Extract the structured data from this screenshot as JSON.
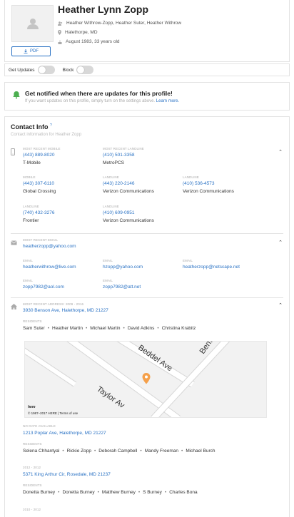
{
  "profile": {
    "name": "Heather Lynn Zopp",
    "aliases": "Heather Withrow-Zopp, Heather Suter, Heather Withrow",
    "location": "Halethorpe, MD",
    "birth": "August 1983, 33 years old",
    "pdf_label": "PDF"
  },
  "toggles": {
    "updates_label": "Get Updates",
    "block_label": "Block"
  },
  "notify": {
    "title": "Get notified when there are updates for this profile!",
    "subtitle": "If you want updates on this profile, simply turn on the settings above.",
    "link": "Learn more."
  },
  "contact": {
    "title": "Contact Info",
    "superscript": "?",
    "subtitle": "Contact information for Heather Zopp"
  },
  "phones": [
    {
      "label": "MOST RECENT MOBILE",
      "number": "(443) 889-8020",
      "carrier": "T-Mobile"
    },
    {
      "label": "MOST RECENT LANDLINE",
      "number": "(410) 501-3358",
      "carrier": "MetroPCS"
    },
    {
      "label": "MOBILE",
      "number": "(443) 307-6110",
      "carrier": "Global Crossing"
    },
    {
      "label": "LANDLINE",
      "number": "(443) 220-2146",
      "carrier": "Verizon Communications"
    },
    {
      "label": "LANDLINE",
      "number": "(410) 536-4573",
      "carrier": "Verizon Communications"
    },
    {
      "label": "LANDLINE",
      "number": "(740) 432-3276",
      "carrier": "Frontier"
    },
    {
      "label": "LANDLINE",
      "number": "(410) 609-0951",
      "carrier": "Verizon Communications"
    }
  ],
  "emails": [
    {
      "label": "MOST RECENT EMAIL",
      "value": "heatherzopp@yahoo.com"
    },
    {
      "label": "EMAIL",
      "value": "heatherwithrow@live.com"
    },
    {
      "label": "EMAIL",
      "value": "hzopp@yahoo.com"
    },
    {
      "label": "EMAIL",
      "value": "heatherzopp@netscape.net"
    },
    {
      "label": "EMAIL",
      "value": "zopp7982@aol.com"
    },
    {
      "label": "EMAIL",
      "value": "zopp7982@att.net"
    }
  ],
  "addresses": [
    {
      "label": "MOST RECENT ADDRESS: 2009 - 2016",
      "address": "3930 Benson Ave, Halethorpe, MD 21227",
      "residents_label": "RESIDENTS",
      "residents": [
        "Sam Suter",
        "Heather Martin",
        "Michael Martin",
        "David Adkins",
        "Christina Krabitz"
      ]
    },
    {
      "label": "NO DATE AVAILABLE",
      "address": "1213 Poplar Ave, Halethorpe, MD 21227",
      "residents_label": "RESIDENTS",
      "residents": [
        "Selena Chhantyal",
        "Rickie Zopp",
        "Deborah Campbell",
        "Mandy Freeman",
        "Michael Burch"
      ]
    },
    {
      "label": "2012 - 2012",
      "address": "5371 King Arthur Cir, Rosedale, MD 21237",
      "residents_label": "RESIDENTS",
      "residents": [
        "Donetta Burney",
        "Donetta Burney",
        "Matthew Burney",
        "S Burney",
        "Charles Bona"
      ]
    },
    {
      "label": "2010 - 2012"
    }
  ],
  "map": {
    "street1": "Beddel Ave",
    "street2": "Benson",
    "street3": "Taylor Av",
    "logo": "here",
    "copyright": "© 1987–2017 HERE | Terms of use"
  },
  "colors": {
    "link": "#2a72c4",
    "accent_orange": "#f5a04a",
    "notify_green": "#4caf50"
  }
}
